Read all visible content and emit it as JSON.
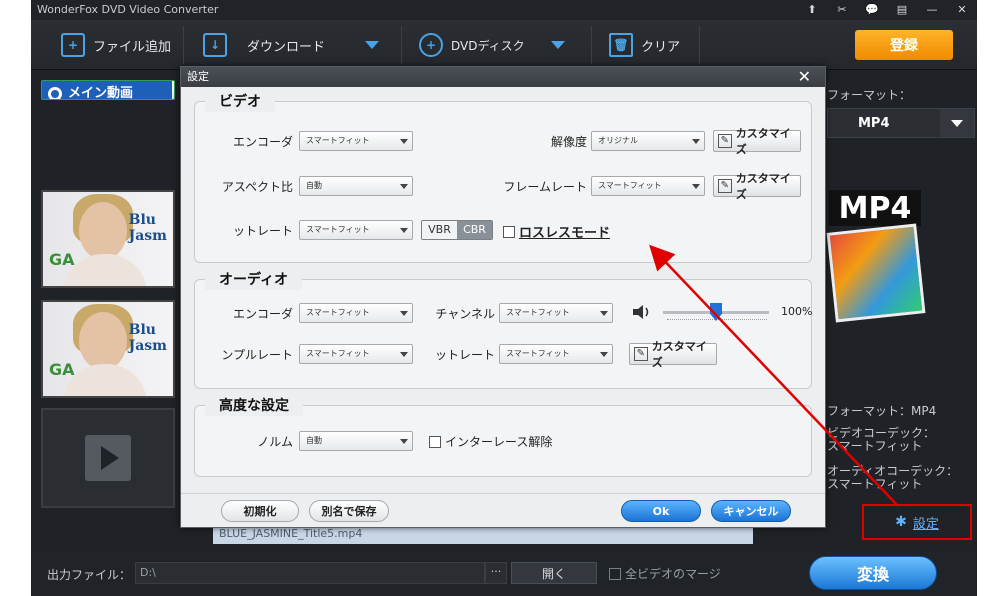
{
  "window": {
    "title": "WonderFox DVD Video Converter",
    "controls": [
      "⬆",
      "✂",
      "💬",
      "▤",
      "—",
      "✕"
    ]
  },
  "toolbar": {
    "add_file": "ファイル追加",
    "download": "ダウンロード",
    "dvd_disc": "DVDディスク",
    "clear": "クリア",
    "register": "登録"
  },
  "left": {
    "main_video": "メイン動画"
  },
  "right": {
    "format_label": "フォーマット：",
    "format_value": "MP4",
    "mp4_art": "MP4",
    "info_format": "フォーマット：MP4",
    "info_video_codec": "ビデオコーデック：\nスマートフィット",
    "info_audio_codec": "オーディオコーデック：\nスマートフィット",
    "settings_link": "設定"
  },
  "file_row": "BLUE_JASMINE_Title5.mp4",
  "bottom": {
    "output_label": "出力ファイル：",
    "output_path": "D:\\",
    "browse": "···",
    "open": "開く",
    "merge": "全ビデオのマージ",
    "convert": "変換"
  },
  "dialog": {
    "title": "設定",
    "close": "✕",
    "video": {
      "group_title": "ビデオ",
      "encoder_label": "エンコーダ",
      "encoder_value": "スマートフィット",
      "resolution_label": "解像度",
      "resolution_value": "オリジナル",
      "customize": "カスタマイズ",
      "aspect_label": "アスペクト比",
      "aspect_value": "自動",
      "framerate_label": "フレームレート",
      "framerate_value": "スマートフィット",
      "bitrate_label": "ットレート",
      "bitrate_value": "スマートフィット",
      "vbr": "VBR",
      "cbr": "CBR",
      "lossless": "ロスレスモード"
    },
    "audio": {
      "group_title": "オーディオ",
      "encoder_label": "エンコーダ",
      "encoder_value": "スマートフィット",
      "channel_label": "チャンネル",
      "channel_value": "スマートフィット",
      "volume": "100%",
      "volume_level": 0.5,
      "samplerate_label": "ンプルレート",
      "samplerate_value": "スマートフィット",
      "bitrate_label": "ットレート",
      "bitrate_value": "スマートフィット",
      "customize": "カスタマイズ"
    },
    "advanced": {
      "group_title": "高度な設定",
      "norm_label": "ノルム",
      "norm_value": "自動",
      "deinterlace": "インターレース解除"
    },
    "buttons": {
      "reset": "初期化",
      "save_as": "別名で保存",
      "ok": "Ok",
      "cancel": "キャンセル"
    }
  },
  "colors": {
    "accent": "#1f72d6",
    "register": "#f39800",
    "highlight_box": "#e00000",
    "arrow": "#e00000"
  }
}
